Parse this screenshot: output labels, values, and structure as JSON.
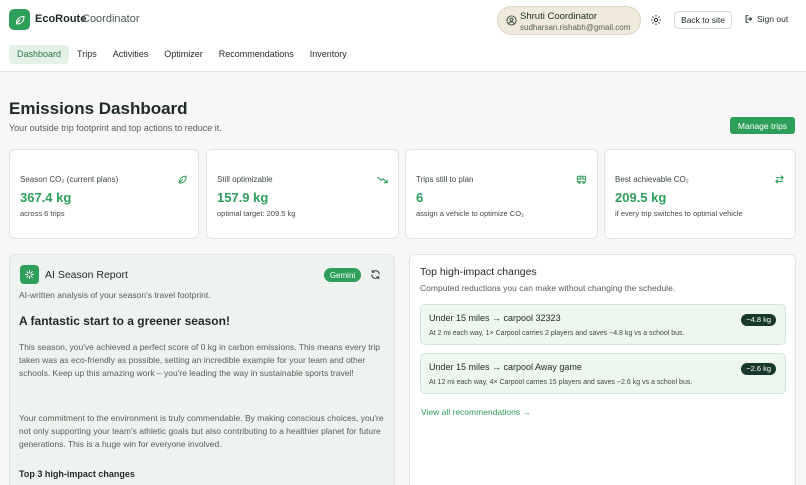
{
  "header": {
    "brand": "EcoRoute",
    "brand_sub": "Coordinator",
    "user_name": "Shruti Coordinator",
    "user_email": "sudharsan.rishabh@gmail.com",
    "back_label": "Back to site",
    "signout_label": "Sign out"
  },
  "nav": [
    {
      "label": "Dashboard",
      "active": true
    },
    {
      "label": "Trips"
    },
    {
      "label": "Activities"
    },
    {
      "label": "Optimizer"
    },
    {
      "label": "Recommendations"
    },
    {
      "label": "Inventory"
    }
  ],
  "page": {
    "title": "Emissions Dashboard",
    "subtitle": "Your outside trip footprint and top actions to reduce it.",
    "manage_label": "Manage trips"
  },
  "stats": [
    {
      "label": "Season CO₂ (current plans)",
      "value": "367.4 kg",
      "note": "across 6 trips",
      "icon": "leaf-icon"
    },
    {
      "label": "Still optimizable",
      "value": "157.9 kg",
      "note": "optimal target: 209.5 kg",
      "icon": "trending-down-icon"
    },
    {
      "label": "Trips still to plan",
      "value": "6",
      "note": "assign a vehicle to optimize CO₂",
      "icon": "bus-icon"
    },
    {
      "label": "Best achievable CO₂",
      "value": "209.5 kg",
      "note": "if every trip switches to optimal vehicle",
      "icon": "swap-icon"
    }
  ],
  "ai": {
    "title": "AI Season Report",
    "badge": "Gemini",
    "subtitle": "AI-written analysis of your season's travel footprint.",
    "headline": "A fantastic start to a greener season!",
    "paragraph1": "This season, you've achieved a perfect score of 0 kg in carbon emissions. This means every trip taken was as eco-friendly as possible, setting an incredible example for your team and other schools. Keep up this amazing work – you're leading the way in sustainable sports travel!",
    "paragraph2": "Your commitment to the environment is truly commendable. By making conscious choices, you're not only supporting your team's athletic goals but also contributing to a healthier planet for future generations. This is a huge win for everyone involved.",
    "top3_label": "Top 3 high-impact changes"
  },
  "changes": {
    "title": "Top high-impact changes",
    "subtitle": "Computed reductions you can make without changing the schedule.",
    "items": [
      {
        "name": "Under 15 miles → carpool 32323",
        "desc": "At 2 mi each way, 1× Carpool carries 2 players and saves ~4.8 kg vs a school bus.",
        "badge": "−4.8 kg"
      },
      {
        "name": "Under 15 miles → carpool Away game",
        "desc": "At 12 mi each way, 4× Carpool carries 15 players and saves ~2.6 kg vs a school bus.",
        "badge": "−2.6 kg"
      }
    ],
    "link_label": "View all recommendations →"
  },
  "colors": {
    "accent": "#2e9e5b",
    "badge_dark": "#17382a"
  }
}
